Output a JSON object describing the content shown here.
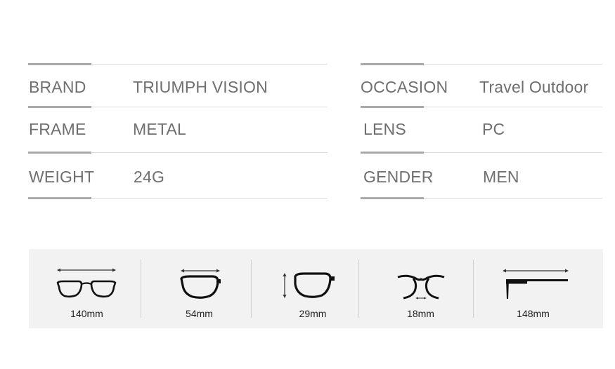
{
  "specs": {
    "left": [
      {
        "label": "BRAND",
        "value": "TRIUMPH VISION"
      },
      {
        "label": "FRAME",
        "value": "METAL"
      },
      {
        "label": "WEIGHT",
        "value": "24G"
      }
    ],
    "right": [
      {
        "label": "OCCASION",
        "value": "Travel Outdoor"
      },
      {
        "label": "LENS",
        "value": "PC"
      },
      {
        "label": "GENDER",
        "value": "MEN"
      }
    ]
  },
  "measurements": [
    {
      "value": "140mm",
      "icon": "frame-width-icon"
    },
    {
      "value": "54mm",
      "icon": "lens-width-icon"
    },
    {
      "value": "29mm",
      "icon": "lens-height-icon"
    },
    {
      "value": "18mm",
      "icon": "bridge-width-icon"
    },
    {
      "value": "148mm",
      "icon": "temple-length-icon"
    }
  ],
  "colors": {
    "text": "#6f6f6f",
    "accent_line": "#a9a9a9",
    "divider": "#dcdcdc",
    "panel_bg": "#f2f2f2"
  }
}
